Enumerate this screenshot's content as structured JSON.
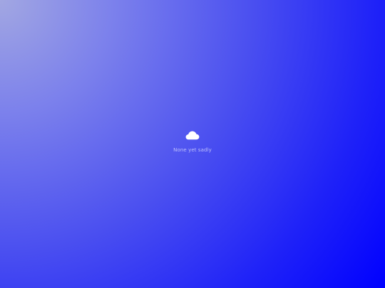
{
  "background": {
    "top_left_color": "#a2a7e2",
    "bottom_right_color": "#0000ff"
  },
  "empty_state": {
    "icon": "cloud-icon",
    "message": "None yet sadly",
    "icon_color": "#ffffff",
    "text_color": "#dcdeff"
  }
}
